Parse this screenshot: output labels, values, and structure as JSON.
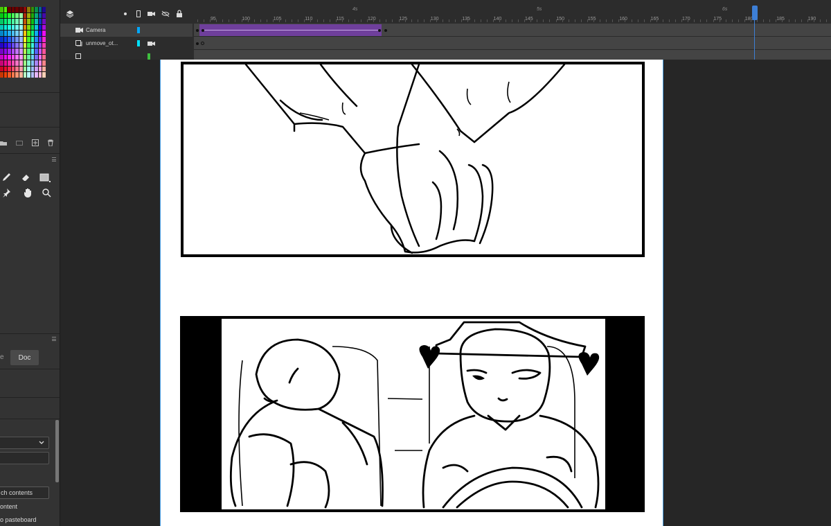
{
  "timeline": {
    "ruler_ticks": [
      "95",
      "100",
      "105",
      "110",
      "115",
      "120",
      "125",
      "130",
      "135",
      "140",
      "145",
      "150",
      "155",
      "160",
      "165",
      "170",
      "175",
      "180",
      "185",
      "190"
    ],
    "seconds_labels": [
      "4s",
      "5s",
      "6s"
    ],
    "current_frame": 180,
    "layers": [
      {
        "name": "Camera",
        "color": "#00a8ff"
      },
      {
        "name": "unmove_ot...",
        "color": "#00e0ff"
      }
    ]
  },
  "left_panel": {
    "tabs": {
      "first_partial": "e",
      "doc": "Doc"
    },
    "buttons": {
      "match_contents": "ch contents"
    },
    "labels": {
      "content": "ontent",
      "pasteboard": "o pasteboard"
    }
  }
}
